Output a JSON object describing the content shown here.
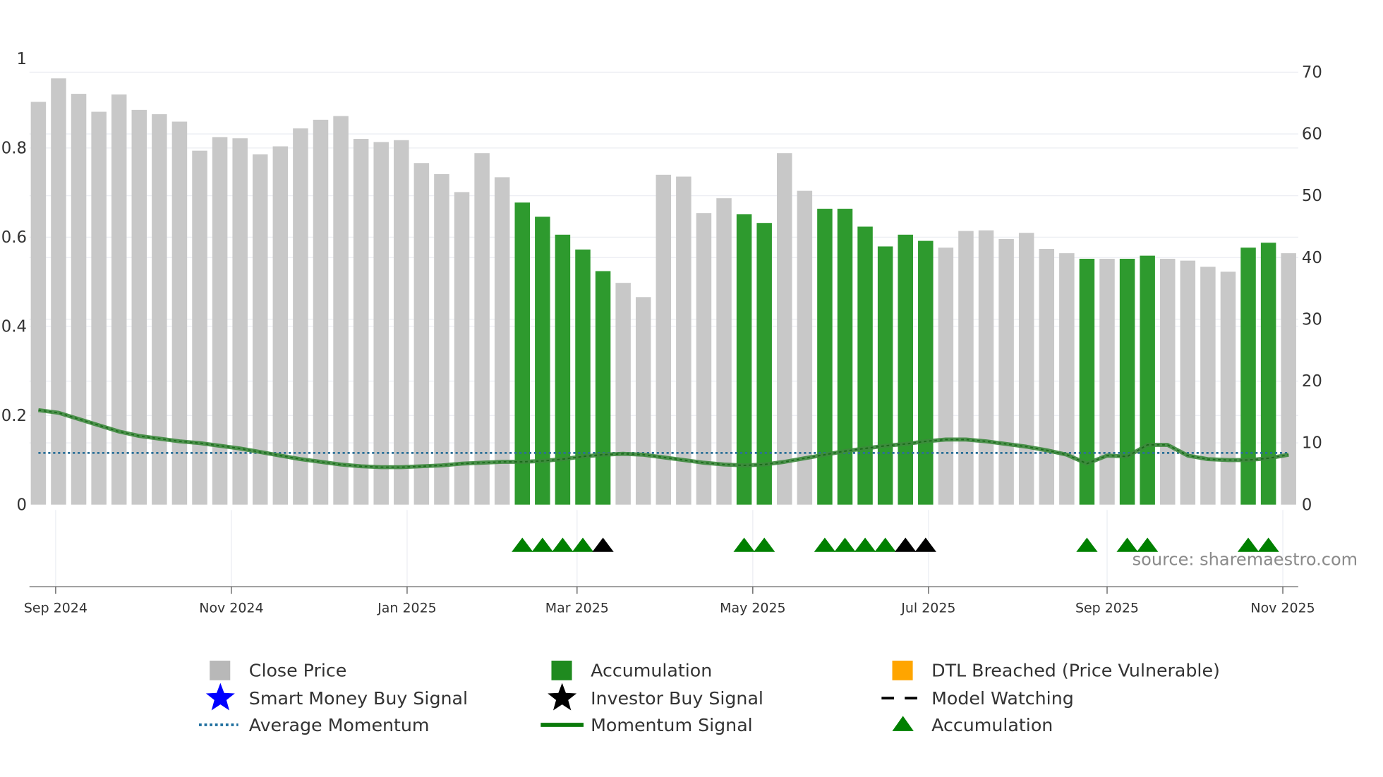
{
  "chart_data": {
    "type": "bar",
    "title": "",
    "start_date": "2024-08-26",
    "interval_days": 7,
    "close_price": [
      65.2,
      69.0,
      66.5,
      63.6,
      66.4,
      63.9,
      63.2,
      62.0,
      57.3,
      59.5,
      59.3,
      56.7,
      58.0,
      60.9,
      62.3,
      62.9,
      59.2,
      58.7,
      59.0,
      55.3,
      53.5,
      50.6,
      56.9,
      53.0,
      48.9,
      46.6,
      43.7,
      41.3,
      37.8,
      35.9,
      33.6,
      53.4,
      53.1,
      47.2,
      49.6,
      47.0,
      45.6,
      56.9,
      50.8,
      47.9,
      47.9,
      45.0,
      41.8,
      43.7,
      42.7,
      41.6,
      44.3,
      44.4,
      43.0,
      44.0,
      41.4,
      40.7,
      39.8,
      39.8,
      39.8,
      40.3,
      39.8,
      39.5,
      38.5,
      37.7,
      41.6,
      42.4,
      40.7
    ],
    "accumulation_bars": [
      24,
      25,
      26,
      27,
      28,
      35,
      36,
      39,
      40,
      41,
      42,
      43,
      44,
      52,
      54,
      55,
      60,
      61
    ],
    "momentum_signal": [
      0.212,
      0.206,
      0.192,
      0.178,
      0.164,
      0.154,
      0.148,
      0.142,
      0.138,
      0.132,
      0.126,
      0.118,
      0.11,
      0.102,
      0.096,
      0.09,
      0.086,
      0.084,
      0.084,
      0.086,
      0.088,
      0.092,
      0.094,
      0.096,
      0.096,
      0.098,
      0.102,
      0.108,
      0.112,
      0.114,
      0.112,
      0.106,
      0.1,
      0.094,
      0.09,
      0.088,
      0.09,
      0.096,
      0.104,
      0.112,
      0.12,
      0.126,
      0.132,
      0.136,
      0.142,
      0.146,
      0.146,
      0.142,
      0.136,
      0.13,
      0.122,
      0.112,
      0.092,
      0.11,
      0.108,
      0.134,
      0.134,
      0.11,
      0.102,
      0.1,
      0.1,
      0.104,
      0.112
    ],
    "average_momentum": 0.116,
    "accumulation_markers": [
      24,
      25,
      26,
      27,
      35,
      36,
      39,
      40,
      41,
      42,
      52,
      54,
      55,
      60,
      61
    ],
    "investor_buy_markers": [
      28,
      43,
      44
    ],
    "left_axis": {
      "range": [
        0,
        1
      ],
      "ticks": [
        "0",
        "0.2",
        "0.4",
        "0.6",
        "0.8",
        "1"
      ],
      "values": [
        0,
        0.2,
        0.4,
        0.6,
        0.8,
        1
      ]
    },
    "right_axis": {
      "range": [
        0,
        70
      ],
      "ticks": [
        "0",
        "10",
        "20",
        "30",
        "40",
        "50",
        "60",
        "70"
      ],
      "values": [
        0,
        10,
        20,
        30,
        40,
        50,
        60,
        70
      ]
    },
    "x_ticks": [
      {
        "label": "Sep 2024",
        "date": "2024-09-01"
      },
      {
        "label": "Nov 2024",
        "date": "2024-11-01"
      },
      {
        "label": "Jan 2025",
        "date": "2025-01-01"
      },
      {
        "label": "Mar 2025",
        "date": "2025-03-01"
      },
      {
        "label": "May 2025",
        "date": "2025-05-01"
      },
      {
        "label": "Jul 2025",
        "date": "2025-07-01"
      },
      {
        "label": "Sep 2025",
        "date": "2025-09-01"
      },
      {
        "label": "Nov 2025",
        "date": "2025-11-01"
      }
    ],
    "legend": [
      {
        "label": "Close Price",
        "icon": "square",
        "color": "#b8b8b8"
      },
      {
        "label": "Accumulation",
        "icon": "square",
        "color": "#1f8a1f"
      },
      {
        "label": "DTL Breached (Price Vulnerable)",
        "icon": "square",
        "color": "#ffa500"
      },
      {
        "label": "Smart Money Buy Signal",
        "icon": "star",
        "color": "#0000ff"
      },
      {
        "label": "Investor Buy Signal",
        "icon": "star",
        "color": "#000000"
      },
      {
        "label": "Model Watching",
        "icon": "dashed-line",
        "color": "#000000"
      },
      {
        "label": "Average Momentum",
        "icon": "dotted-line",
        "color": "#1f6f9f"
      },
      {
        "label": "Momentum Signal",
        "icon": "solid-line",
        "color": "#0a7a0a"
      },
      {
        "label": "Accumulation",
        "icon": "triangle",
        "color": "#008000"
      }
    ],
    "legend_placement": "bottom",
    "source": "source: sharemaestro.com",
    "colors": {
      "bar": "#c8c8c8",
      "accum": "#2e9a2e",
      "momentum": "#3d8a3d",
      "avg": "#2a6f97",
      "marker": "#008000",
      "investor": "#000000",
      "grid": "#ebedf2"
    }
  }
}
